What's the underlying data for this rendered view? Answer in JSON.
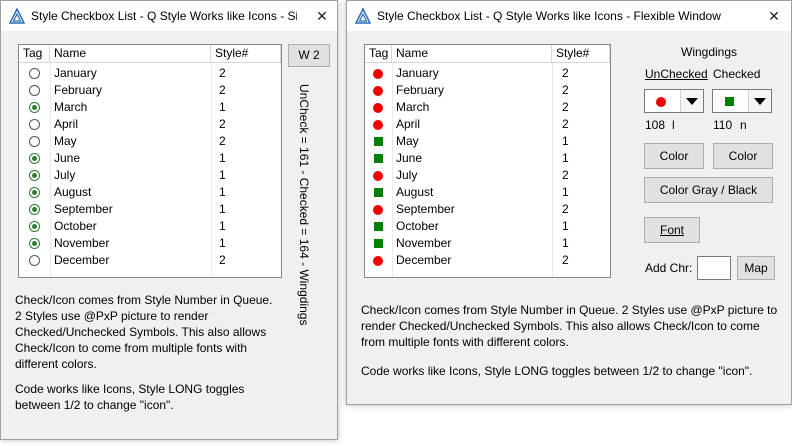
{
  "left_window": {
    "title": "Style Checkbox List - Q Style Works like Icons - Si...",
    "close": "✕",
    "headers": {
      "tag": "Tag",
      "name": "Name",
      "style": "Style#"
    },
    "button": "W 2",
    "vertical_text": "UnCheck = 161   -   Checked = 164   -   Wingdings",
    "rows": [
      {
        "name": "January",
        "style": "2",
        "checked": false
      },
      {
        "name": "February",
        "style": "2",
        "checked": false
      },
      {
        "name": "March",
        "style": "1",
        "checked": true
      },
      {
        "name": "April",
        "style": "2",
        "checked": false
      },
      {
        "name": "May",
        "style": "2",
        "checked": false
      },
      {
        "name": "June",
        "style": "1",
        "checked": true
      },
      {
        "name": "July",
        "style": "1",
        "checked": true
      },
      {
        "name": "August",
        "style": "1",
        "checked": true
      },
      {
        "name": "September",
        "style": "1",
        "checked": true
      },
      {
        "name": "October",
        "style": "1",
        "checked": true
      },
      {
        "name": "November",
        "style": "1",
        "checked": true
      },
      {
        "name": "December",
        "style": "2",
        "checked": false
      }
    ],
    "desc1": [
      "Check/Icon comes from Style Number in Queue.",
      "2 Styles use @PxP picture to render",
      "Checked/Unchecked Symbols. This also allows",
      "Check/Icon to come from multiple fonts with",
      "different colors."
    ],
    "desc2": [
      "Code works like Icons, Style LONG toggles",
      "between 1/2 to change \"icon\"."
    ]
  },
  "right_window": {
    "title": "Style Checkbox List - Q Style Works like Icons - Flexible Window",
    "close": "✕",
    "headers": {
      "tag": "Tag",
      "name": "Name",
      "style": "Style#"
    },
    "rows": [
      {
        "name": "January",
        "style": "2",
        "checked": false
      },
      {
        "name": "February",
        "style": "2",
        "checked": false
      },
      {
        "name": "March",
        "style": "2",
        "checked": false
      },
      {
        "name": "April",
        "style": "2",
        "checked": false
      },
      {
        "name": "May",
        "style": "1",
        "checked": true
      },
      {
        "name": "June",
        "style": "1",
        "checked": true
      },
      {
        "name": "July",
        "style": "2",
        "checked": false
      },
      {
        "name": "August",
        "style": "1",
        "checked": true
      },
      {
        "name": "September",
        "style": "2",
        "checked": false
      },
      {
        "name": "October",
        "style": "1",
        "checked": true
      },
      {
        "name": "November",
        "style": "1",
        "checked": true
      },
      {
        "name": "December",
        "style": "2",
        "checked": false
      }
    ],
    "panel": {
      "font_label": "Wingdings",
      "unchecked_label": "UnChecked",
      "checked_label": "Checked",
      "unchecked_code": "108",
      "unchecked_char": "l",
      "checked_code": "110",
      "checked_char": "n",
      "color_btn_1": "Color",
      "color_btn_2": "Color",
      "gray_black_btn": "Color Gray / Black",
      "font_btn": "Font",
      "add_chr_label": "Add Chr:",
      "add_chr_value": "",
      "map_btn": "Map"
    },
    "desc1": [
      "Check/Icon comes from Style Number in Queue. 2 Styles use @PxP picture to",
      "render Checked/Unchecked Symbols. This also allows Check/Icon to come",
      "from multiple fonts with different colors."
    ],
    "desc2": [
      "Code works like Icons, Style LONG toggles between 1/2 to change \"icon\"."
    ]
  },
  "colors": {
    "unchecked_symbol": "#ee0000",
    "checked_symbol": "#008000",
    "radio_checked": "#2e7d32"
  }
}
